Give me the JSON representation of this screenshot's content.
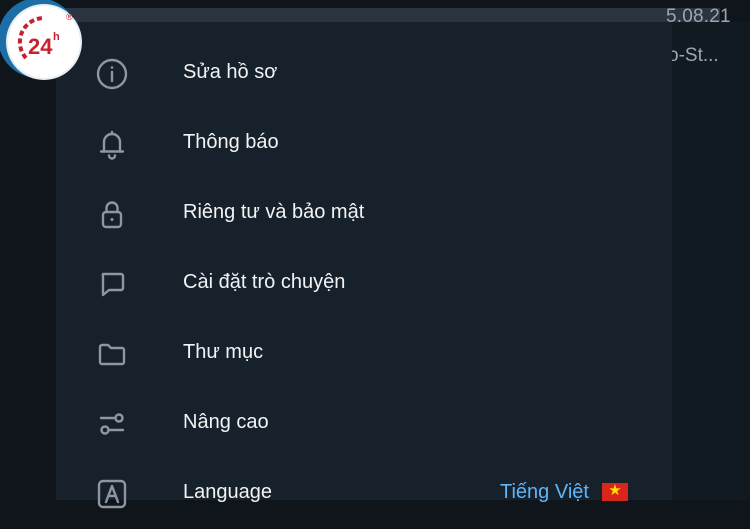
{
  "background": {
    "date": "5.08.21",
    "preview": "o-St..."
  },
  "logo": {
    "text": "24",
    "superscript": "h",
    "registered": "®"
  },
  "menu": {
    "items": [
      {
        "label": "Sửa hồ sơ",
        "icon": "info-icon"
      },
      {
        "label": "Thông báo",
        "icon": "bell-icon"
      },
      {
        "label": "Riêng tư và bảo mật",
        "icon": "lock-icon"
      },
      {
        "label": "Cài đặt trò chuyện",
        "icon": "chat-bubble-icon"
      },
      {
        "label": "Thư mục",
        "icon": "folder-icon"
      },
      {
        "label": "Nâng cao",
        "icon": "sliders-icon"
      },
      {
        "label": "Language",
        "icon": "language-icon",
        "value": "Tiếng Việt",
        "flag": "★"
      }
    ]
  },
  "colors": {
    "panel": "#17212b",
    "text": "#f1f3f5",
    "icon": "#8d97a2",
    "accent": "#5eb5f7"
  }
}
